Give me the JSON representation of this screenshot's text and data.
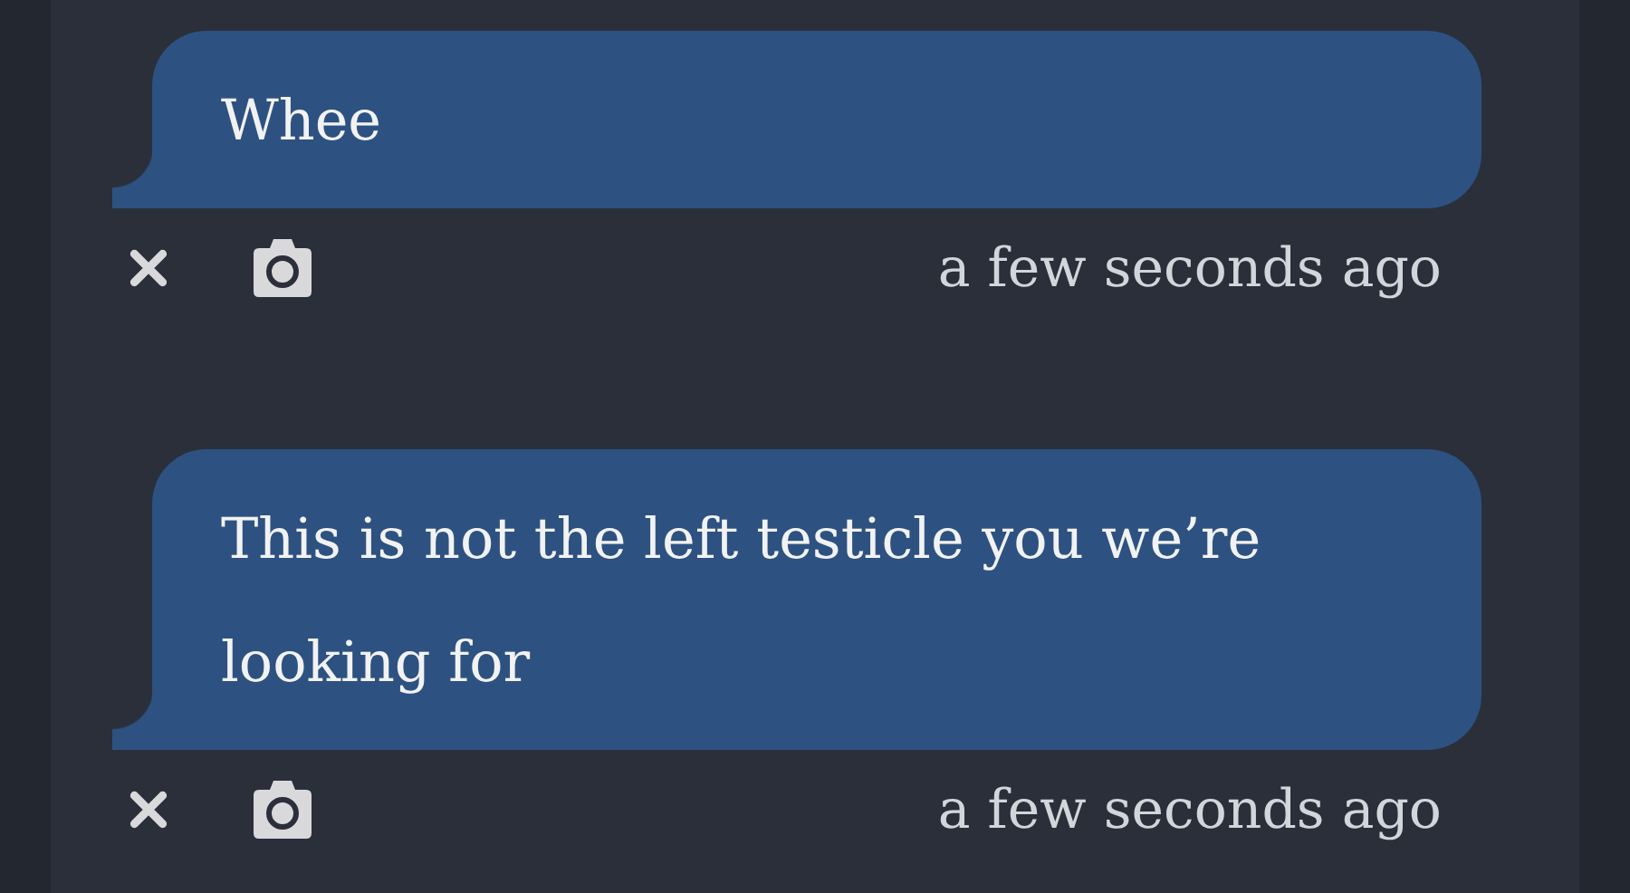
{
  "messages": [
    {
      "text": "Whee",
      "time": "a few seconds ago"
    },
    {
      "text": "This is not the left testicle you we’re looking for",
      "time": "a few seconds ago"
    }
  ]
}
